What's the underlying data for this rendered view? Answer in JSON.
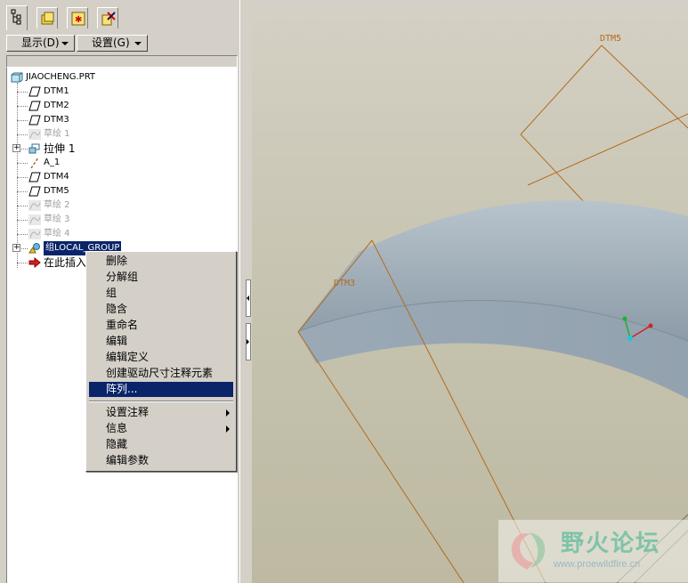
{
  "toolbar": {
    "show_label": "显示(D)",
    "settings_label": "设置(G)"
  },
  "tree": {
    "items": [
      {
        "label": "JIAOCHENG.PRT",
        "icon": "part-icon"
      },
      {
        "label": "DTM1",
        "icon": "datum-plane-icon"
      },
      {
        "label": "DTM2",
        "icon": "datum-plane-icon"
      },
      {
        "label": "DTM3",
        "icon": "datum-plane-icon"
      },
      {
        "label": "草绘 1",
        "icon": "sketch-icon"
      },
      {
        "label": "拉伸 1",
        "icon": "extrude-icon"
      },
      {
        "label": "A_1",
        "icon": "datum-axis-icon"
      },
      {
        "label": "DTM4",
        "icon": "datum-plane-icon"
      },
      {
        "label": "DTM5",
        "icon": "datum-plane-icon"
      },
      {
        "label": "草绘 2",
        "icon": "sketch-icon"
      },
      {
        "label": "草绘 3",
        "icon": "sketch-icon"
      },
      {
        "label": "草绘 4",
        "icon": "sketch-icon"
      },
      {
        "label": "组LOCAL_GROUP",
        "icon": "group-icon"
      },
      {
        "label": "在此插入",
        "icon": "insert-arrow-icon"
      }
    ]
  },
  "context_menu": {
    "items": [
      "删除",
      "分解组",
      "组",
      "隐含",
      "重命名",
      "编辑",
      "编辑定义",
      "创建驱动尺寸注释元素",
      "阵列..."
    ],
    "items2": [
      "设置注释",
      "信息",
      "隐藏",
      "编辑参数"
    ]
  },
  "viewport": {
    "dtm5_label": "DTM5",
    "dtm3_label": "DTM3"
  },
  "watermark": {
    "title": "野火论坛",
    "url": "www.proewildfire.cn"
  },
  "colors": {
    "selection": "#0a246a",
    "datum": "#b36b1c",
    "model": "#94a4b2"
  }
}
